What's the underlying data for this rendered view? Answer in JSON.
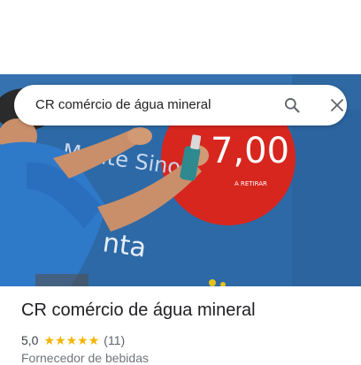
{
  "search": {
    "query": "CR comércio de água mineral",
    "search_icon": "search-icon",
    "close_icon": "close-icon"
  },
  "photo": {
    "sign_price": "7,00",
    "sign_small_text": "A RETIRAR",
    "wall_text_1": "Monte Sino",
    "wall_text_2": "nta"
  },
  "place": {
    "title": "CR comércio de água mineral",
    "rating": "5,0",
    "stars": 5,
    "review_count": "(11)",
    "category": "Fornecedor de bebidas"
  },
  "colors": {
    "star": "#f5b400",
    "wall_blue": "#2f6aa8",
    "sign_red": "#d7261e"
  }
}
